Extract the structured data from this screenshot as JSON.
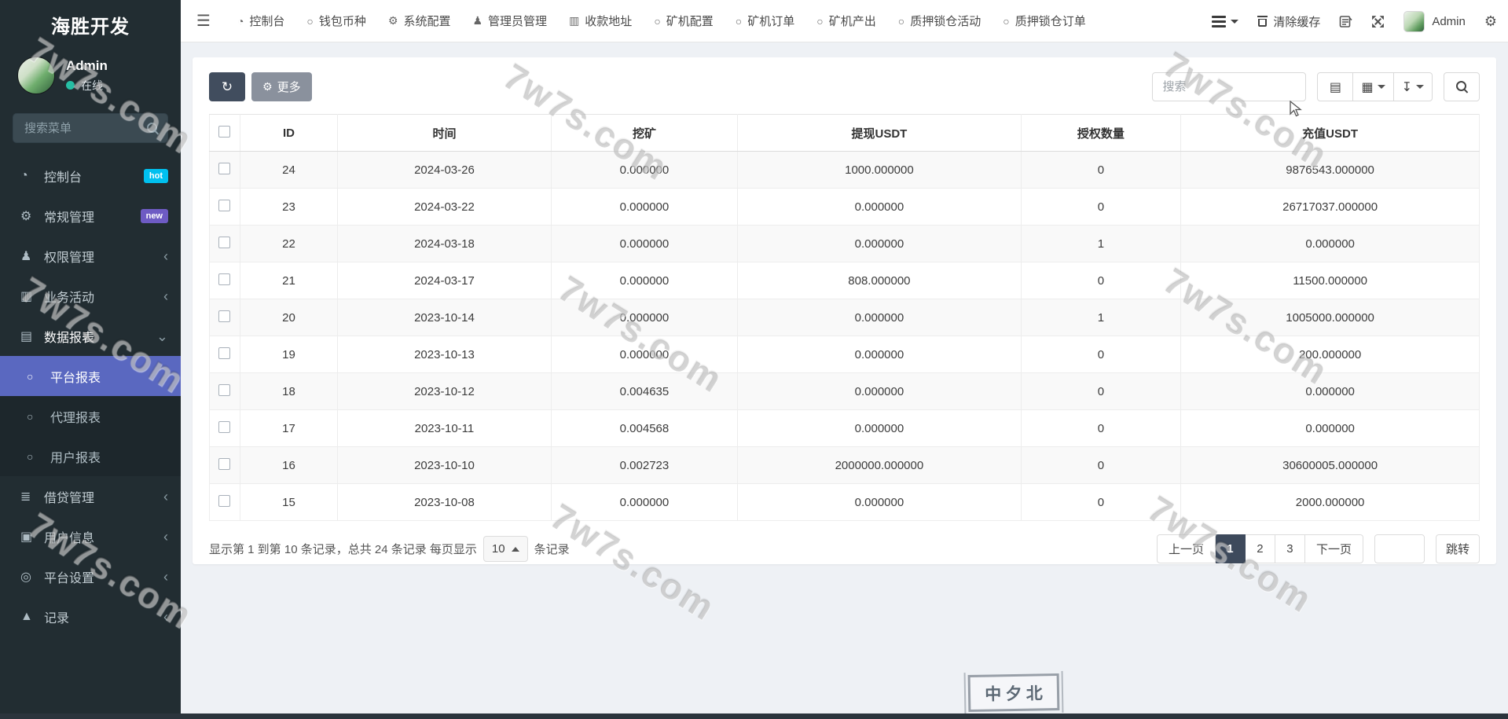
{
  "brand": {
    "title": "海胜开发"
  },
  "user": {
    "name": "Admin",
    "status": "在线",
    "status_color": "#26bfa5"
  },
  "sidebar": {
    "search_placeholder": "搜索菜单",
    "items": [
      {
        "name": "console",
        "label": "控制台",
        "icon": "dashboard-icon",
        "badge": "hot",
        "badge_color": "#00c0ef"
      },
      {
        "name": "general-manage",
        "label": "常规管理",
        "icon": "gears-icon",
        "badge": "new",
        "badge_color": "#6e5bc4"
      },
      {
        "name": "permission-manage",
        "label": "权限管理",
        "icon": "users-icon",
        "chevron": "left"
      },
      {
        "name": "business-activity",
        "label": "业务活动",
        "icon": "id-card-icon",
        "chevron": "left"
      },
      {
        "name": "data-reports",
        "label": "数据报表",
        "icon": "file-icon",
        "chevron": "down",
        "expanded": true,
        "children": [
          {
            "name": "platform-report",
            "label": "平台报表",
            "active": true
          },
          {
            "name": "agent-report",
            "label": "代理报表",
            "active": false
          },
          {
            "name": "user-report",
            "label": "用户报表",
            "active": false
          }
        ]
      },
      {
        "name": "loan-manage",
        "label": "借贷管理",
        "icon": "list-icon",
        "chevron": "left"
      },
      {
        "name": "user-info",
        "label": "用户信息",
        "icon": "address-book-icon",
        "chevron": "left"
      },
      {
        "name": "platform-settings",
        "label": "平台设置",
        "icon": "bullseye-icon",
        "chevron": "left"
      },
      {
        "name": "records",
        "label": "记录",
        "icon": "area-chart-icon",
        "chevron": "left"
      }
    ],
    "active_color": "#5a68c0"
  },
  "navbar": {
    "items": [
      {
        "name": "console",
        "label": "控制台",
        "icon": "dashboard-icon"
      },
      {
        "name": "wallet-coins",
        "label": "钱包币种",
        "icon": "circle-icon"
      },
      {
        "name": "system-config",
        "label": "系统配置",
        "icon": "gear-icon"
      },
      {
        "name": "admin-manage",
        "label": "管理员管理",
        "icon": "user-icon"
      },
      {
        "name": "payment-address",
        "label": "收款地址",
        "icon": "address-card-icon"
      },
      {
        "name": "miner-config",
        "label": "矿机配置",
        "icon": "circle-icon"
      },
      {
        "name": "miner-orders",
        "label": "矿机订单",
        "icon": "circle-icon"
      },
      {
        "name": "miner-output",
        "label": "矿机产出",
        "icon": "circle-icon"
      },
      {
        "name": "pledge-activity",
        "label": "质押锁仓活动",
        "icon": "circle-icon"
      },
      {
        "name": "pledge-orders",
        "label": "质押锁仓订单",
        "icon": "circle-icon"
      }
    ],
    "clear_cache_label": "清除缓存",
    "admin_label": "Admin"
  },
  "toolbar": {
    "more_label": "更多",
    "search_placeholder": "搜索"
  },
  "table": {
    "headers": [
      "ID",
      "时间",
      "挖矿",
      "提现USDT",
      "授权数量",
      "充值USDT"
    ],
    "rows": [
      [
        "24",
        "2024-03-26",
        "0.000000",
        "1000.000000",
        "0",
        "9876543.000000"
      ],
      [
        "23",
        "2024-03-22",
        "0.000000",
        "0.000000",
        "0",
        "26717037.000000"
      ],
      [
        "22",
        "2024-03-18",
        "0.000000",
        "0.000000",
        "1",
        "0.000000"
      ],
      [
        "21",
        "2024-03-17",
        "0.000000",
        "808.000000",
        "0",
        "11500.000000"
      ],
      [
        "20",
        "2023-10-14",
        "0.000000",
        "0.000000",
        "1",
        "1005000.000000"
      ],
      [
        "19",
        "2023-10-13",
        "0.000000",
        "0.000000",
        "0",
        "200.000000"
      ],
      [
        "18",
        "2023-10-12",
        "0.004635",
        "0.000000",
        "0",
        "0.000000"
      ],
      [
        "17",
        "2023-10-11",
        "0.004568",
        "0.000000",
        "0",
        "0.000000"
      ],
      [
        "16",
        "2023-10-10",
        "0.002723",
        "2000000.000000",
        "0",
        "30600005.000000"
      ],
      [
        "15",
        "2023-10-08",
        "0.000000",
        "0.000000",
        "0",
        "2000.000000"
      ]
    ]
  },
  "pagination": {
    "summary_prefix": "显示第 1 到第 10 条记录，总共 24 条记录 每页显示",
    "page_size": "10",
    "summary_suffix": "条记录",
    "prev_label": "上一页",
    "next_label": "下一页",
    "pages": [
      "1",
      "2",
      "3"
    ],
    "active_page": "1",
    "jump_label": "跳转",
    "active_color": "#3e4a5c"
  },
  "watermark": {
    "text": "7w7s.com"
  },
  "stamp": {
    "chars": [
      "中",
      "夕",
      "北"
    ]
  },
  "icons": {
    "dashboard-icon": "◔",
    "circle-icon": "○",
    "gear-icon": "⚙",
    "gears-icon": "⚙",
    "user-icon": "♟",
    "users-icon": "♟",
    "address-card-icon": "▥",
    "id-card-icon": "▥",
    "file-icon": "▤",
    "list-icon": "≣",
    "address-book-icon": "▣",
    "bullseye-icon": "◎",
    "area-chart-icon": "▲",
    "refresh-icon": "↻",
    "view-list-icon": "▤",
    "view-grid-icon": "▦",
    "export-icon": "↧",
    "chevron-left": "‹",
    "chevron-down": "⌄"
  }
}
